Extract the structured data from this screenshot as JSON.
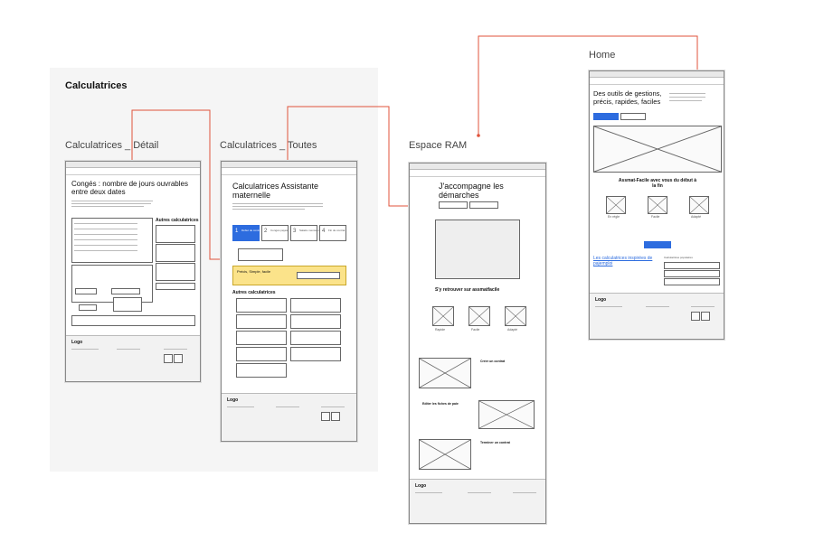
{
  "section": {
    "title": "Calculatrices"
  },
  "frames": {
    "detail": {
      "label": "Calculatrices _ Détail",
      "title": "Congés : nombre de jours ouvrables entre deux dates",
      "aside_title": "Autres calculatrices",
      "logo": "Logo"
    },
    "toutes": {
      "label": "Calculatrices _ Toutes",
      "title": "Calculatrices Assistante maternelle",
      "steps": [
        "1",
        "2",
        "3",
        "4"
      ],
      "step_labels": [
        "Début de contrat",
        "Congés payés",
        "Salaire mensuel",
        "Fin de contrat"
      ],
      "yellow_text": "Précis, Simple, facile",
      "others_title": "Autres calculatrices",
      "logo": "Logo"
    },
    "ram": {
      "label": "Espace RAM",
      "title": "J'accompagne les démarches",
      "sub_title": "S'y retrouver sur assmatfacile",
      "features": [
        "Rapide",
        "Facile",
        "Adapté"
      ],
      "block1": "Créer un contrat",
      "block2": "Editer les fiches de paie",
      "block3": "Terminer un contrat",
      "logo": "Logo"
    },
    "home": {
      "label": "Home",
      "title": "Des outils de gestions, précis, rapides, faciles",
      "sub_title": "Assmat-Facile avec vous du début à la fin",
      "features": [
        "En règle",
        "Facile",
        "Adapté"
      ],
      "link": "Les calculatrices inspirées de pajemploi",
      "popular": "Calculatrices populaires",
      "logo": "Logo"
    }
  },
  "colors": {
    "connector": "#e0533b",
    "accent": "#2d6cdf",
    "highlight": "#fbe38a"
  }
}
